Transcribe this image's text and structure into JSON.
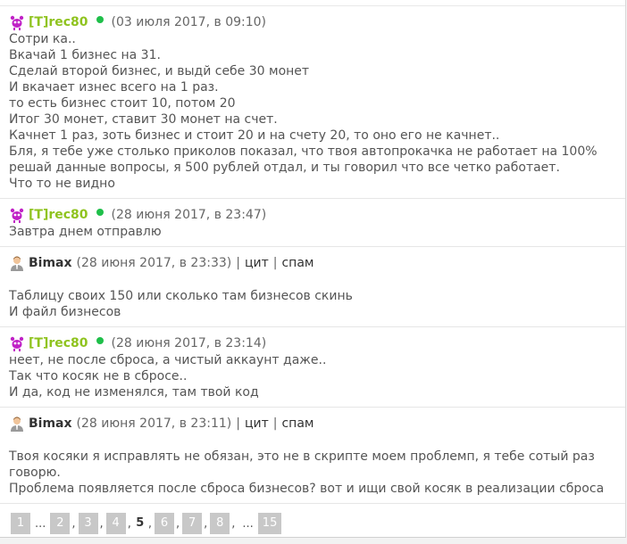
{
  "colors": {
    "admin_name": "#8fc31f",
    "online": "#1fbf4a",
    "page_button": "#c8c8c8"
  },
  "messages": [
    {
      "author": "[T]rec80",
      "date": "(03 июля 2017, в 09:10)",
      "lines": [
        "Сотри ка..",
        "Вкачай 1 бизнес на 31.",
        "Сделай второй бизнес, и выдй себе 30 монет",
        "И вкачает изнес всего на 1 раз.",
        "то есть бизнес стоит 10, потом 20",
        "Итог 30 монет, ставит 30 монет на счет.",
        "Качнет 1 раз, зоть бизнес и стоит 20 и на счету 20, то оно его не качнет..",
        "Бля, я тебе уже столько приколов показал, что твоя автопрокачка не работает на 100%",
        "решай данные вопросы, я 500 рублей отдал, и ты говорил что все четко работает.",
        "Что то не видно"
      ]
    },
    {
      "author": "[T]rec80",
      "date": "(28 июня 2017, в 23:47)",
      "lines": [
        "Завтра днем отправлю"
      ]
    },
    {
      "author": "Bimax",
      "date": "(28 июня 2017, в 23:33)",
      "actions": [
        "цит",
        "спам"
      ],
      "lines": [
        "Таблицу своих 150 или сколько там бизнесов скинь",
        "И файл бизнесов"
      ]
    },
    {
      "author": "[T]rec80",
      "date": "(28 июня 2017, в 23:14)",
      "lines": [
        "неет, не после сброса, а чистый аккаунт даже..",
        "Так что косяк не в сбросе..",
        "И да, код не изменялся, там твой код"
      ]
    },
    {
      "author": "Bimax",
      "date": "(28 июня 2017, в 23:11)",
      "actions": [
        "цит",
        "спам"
      ],
      "lines": [
        "Твоя косяки я исправлять не обязан, это не в скрипте моем проблемп, я тебе сотый раз",
        "говорю.",
        "Проблема появляется после сброса бизнесов? вот и ищи свой косяк в реализации сброса"
      ]
    }
  ],
  "pagination": {
    "first": "1",
    "ellipsis": "...",
    "pages": [
      "2",
      "3",
      "4",
      "5",
      "6",
      "7",
      "8"
    ],
    "current": "5",
    "sep": ",",
    "last": "15"
  }
}
